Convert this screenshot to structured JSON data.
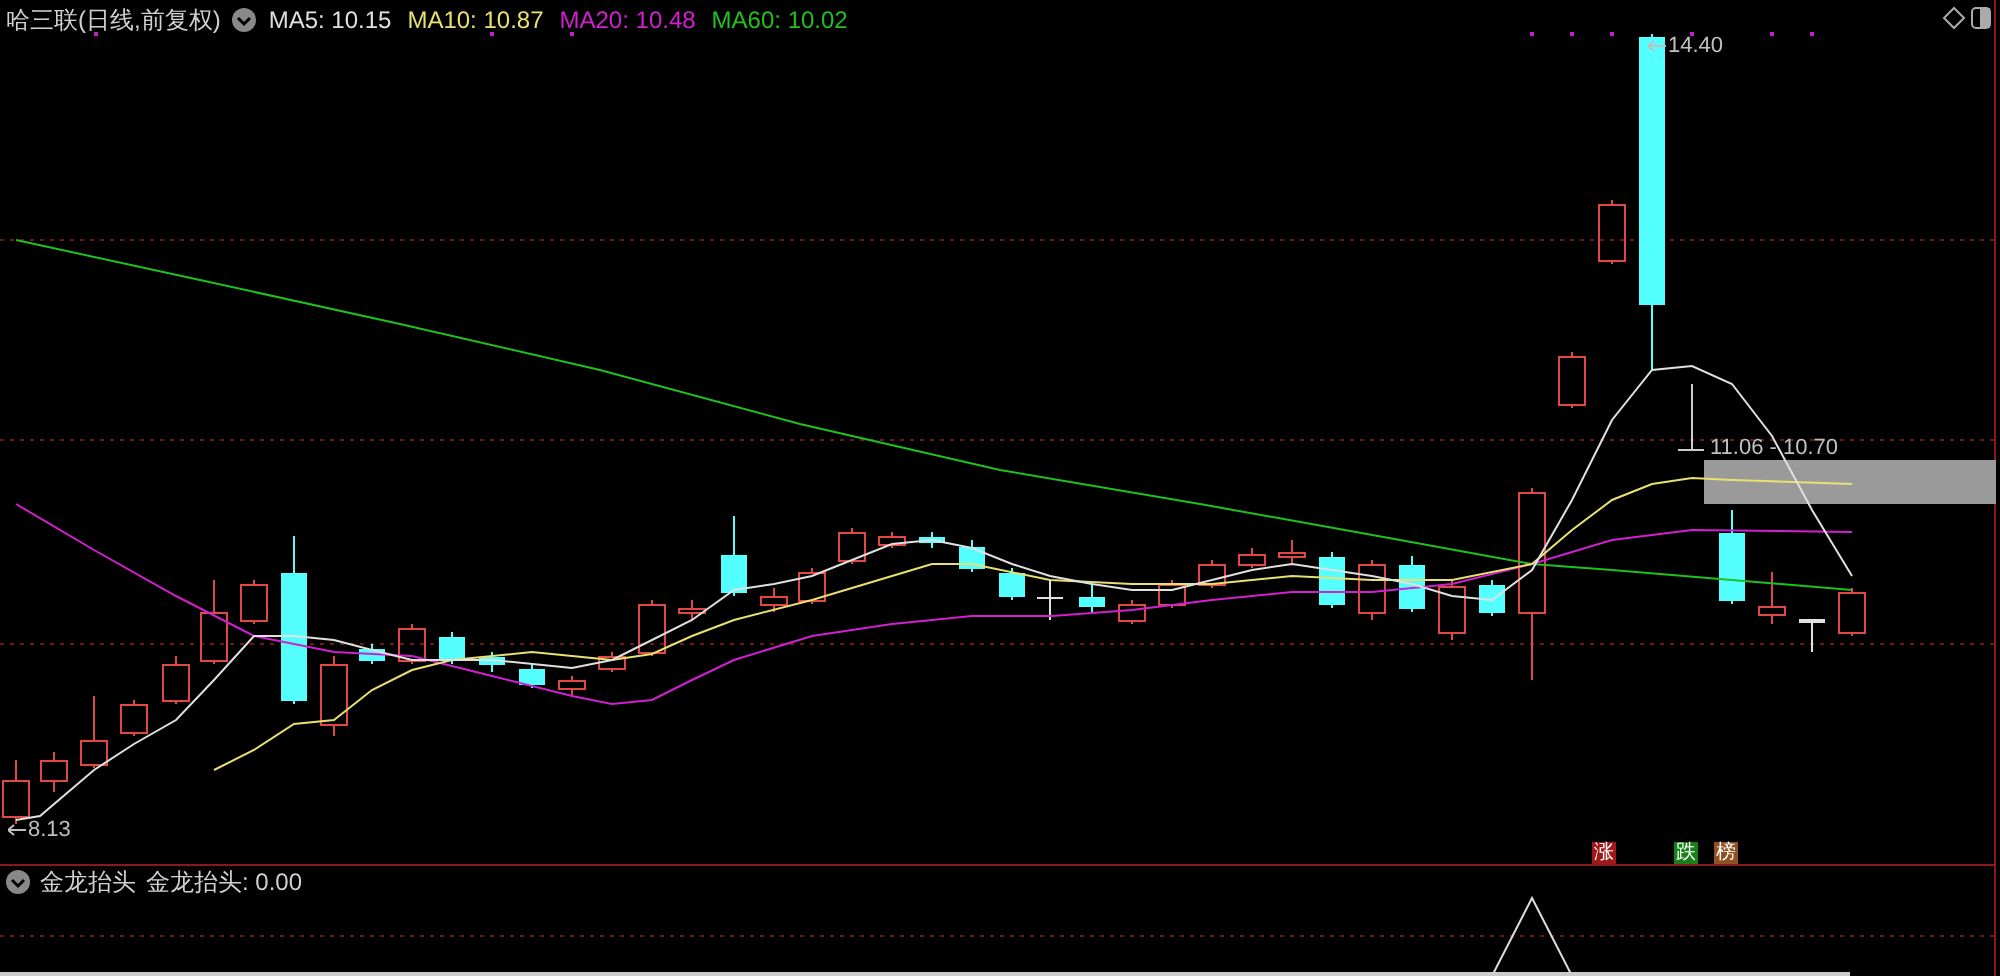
{
  "chart_title": "哈三联(日线,前复权)",
  "ma_legend": [
    {
      "label": "MA5: 10.15",
      "color": "#e0e0e0"
    },
    {
      "label": "MA10: 10.87",
      "color": "#e8e070"
    },
    {
      "label": "MA20: 10.48",
      "color": "#d020d0"
    },
    {
      "label": "MA60: 10.02",
      "color": "#20c020"
    }
  ],
  "high_label": "14.40",
  "low_label": "8.13",
  "range_label": "11.06 - 10.70",
  "signal_tags": [
    {
      "text": "涨",
      "color": "#a01818"
    },
    {
      "text": "跌",
      "color": "#188018"
    },
    {
      "text": "榜",
      "color": "#905020"
    }
  ],
  "indicator": {
    "title": "金龙抬头",
    "value": "金龙抬头: 0.00"
  }
}
